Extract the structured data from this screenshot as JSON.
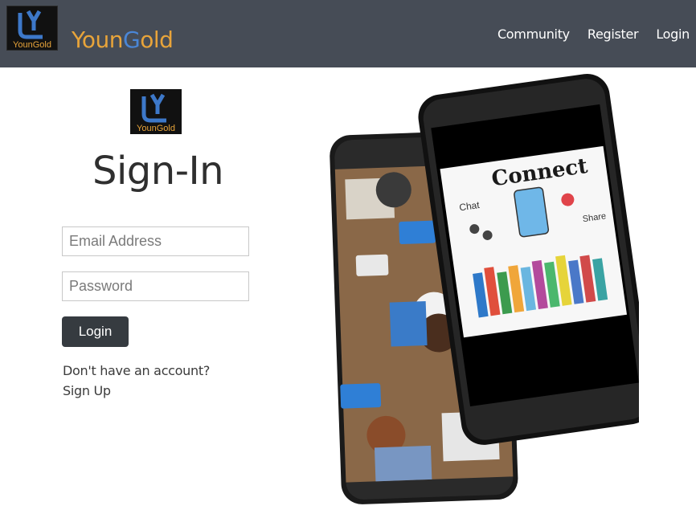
{
  "header": {
    "logo_text": "YounGold",
    "brand": {
      "part1": "Youn",
      "part2": "G",
      "part3": "old"
    },
    "nav": [
      "Community",
      "Register",
      "Login"
    ]
  },
  "form": {
    "logo_text": "YounGold",
    "title": "Sign-In",
    "email_placeholder": "Email Address",
    "password_placeholder": "Password",
    "submit_label": "Login",
    "signup_prompt": "Don't have an account?",
    "signup_link": "Sign Up"
  },
  "illustration": {
    "screen_text": "Connect",
    "labels": [
      "Chat",
      "Share"
    ]
  },
  "colors": {
    "navbar": "#464c56",
    "brand_gold": "#e8a43a",
    "brand_blue": "#4a86d6",
    "button": "#363b40"
  }
}
